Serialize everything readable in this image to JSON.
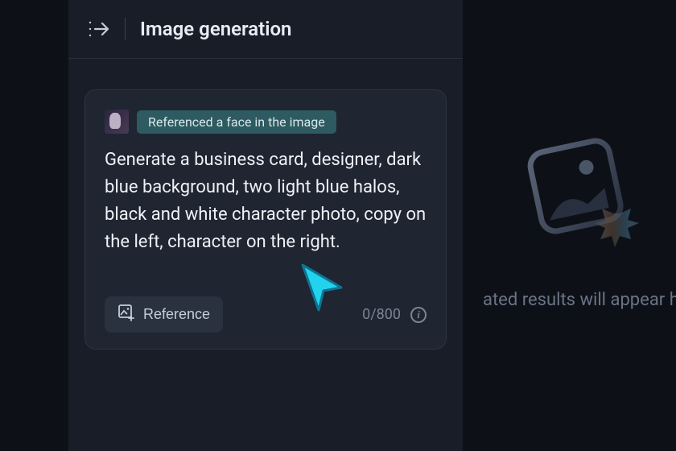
{
  "header": {
    "title": "Image generation"
  },
  "prompt": {
    "reference_badge": "Referenced a face in the image",
    "text": "Generate a business card, designer, dark blue background, two light blue halos, black and white character photo, copy on the left, character on the right.",
    "reference_button": "Reference",
    "counter": "0/800"
  },
  "placeholder": {
    "text": "ated results will appear her"
  }
}
